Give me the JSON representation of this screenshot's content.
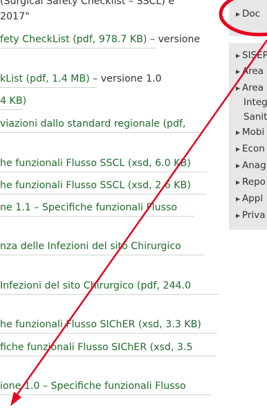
{
  "main": {
    "lines": [
      {
        "text": "(Surgical Safety Checklist – SSCL) e",
        "kind": "plain"
      },
      {
        "text": "2017\"",
        "kind": "plain"
      },
      {
        "text": "fety CheckList (pdf, 978.7 KB)",
        "kind": "link",
        "suffix": " – versione"
      },
      {
        "text": "kList (pdf, 1.4 MB)",
        "kind": "link",
        "suffix": " – versione 1.0"
      },
      {
        "text": "4 KB)",
        "kind": "link",
        "suffix": ""
      },
      {
        "text": "viazioni dallo standard regionale (pdf,",
        "kind": "link",
        "suffix": ""
      },
      {
        "text": "he funzionali Flusso SSCL (xsd, 6.0 KB)",
        "kind": "link",
        "suffix": ""
      },
      {
        "text": "he funzionali Flusso SSCL (xsd, 2.6 KB)",
        "kind": "link",
        "suffix": ""
      },
      {
        "text": "ne 1.1 – Specifiche funzionali Flusso",
        "kind": "link",
        "suffix": ""
      },
      {
        "text": "nza delle Infezioni del sito Chirurgico",
        "kind": "link",
        "suffix": ""
      },
      {
        "text": "Infezioni del sito Chirurgico (pdf, 244.0",
        "kind": "link",
        "suffix": ""
      },
      {
        "text": "he funzionali Flusso SIChER (xsd, 3.3 KB)",
        "kind": "link",
        "suffix": ""
      },
      {
        "text": "fiche funzionali Flusso SIChER (xsd, 3.5",
        "kind": "link",
        "suffix": ""
      },
      {
        "text": "ione 1.0 – Specifiche funzionali Flusso",
        "kind": "link",
        "suffix": ""
      }
    ]
  },
  "sidebar": {
    "top_item": "Doc",
    "items": [
      {
        "label": "SISEP"
      },
      {
        "label": "Area"
      },
      {
        "label": "Area"
      },
      {
        "label": "Integ",
        "cont": true
      },
      {
        "label": "Sanit",
        "cont": true
      },
      {
        "label": "Mobi"
      },
      {
        "label": "Econ"
      },
      {
        "label": "Anag"
      },
      {
        "label": "Repo"
      },
      {
        "label": "Appl"
      },
      {
        "label": "Priva"
      }
    ]
  },
  "annotation": {
    "color": "#e8001c"
  }
}
